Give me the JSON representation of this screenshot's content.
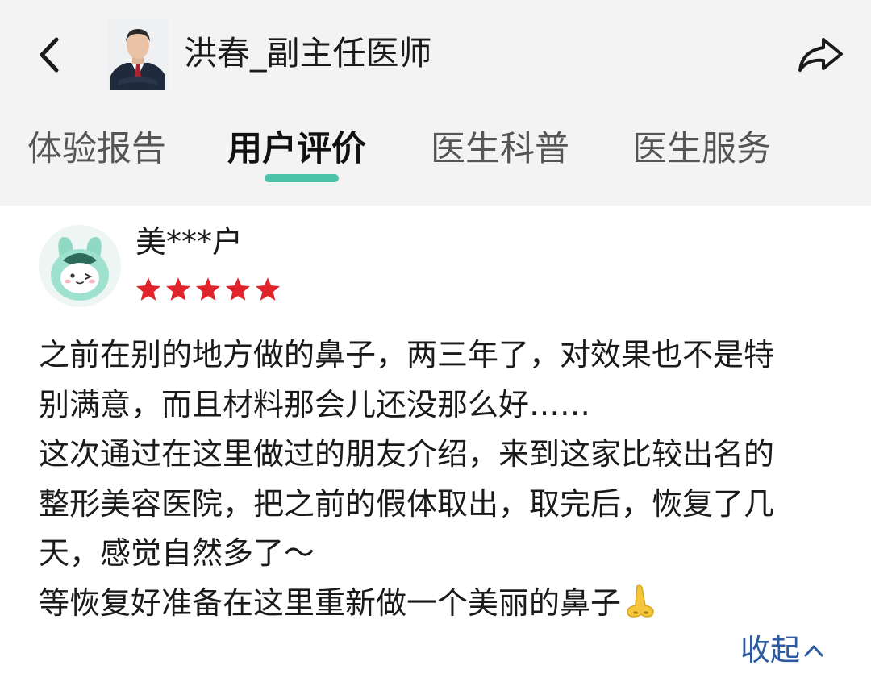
{
  "header": {
    "doctor_name": "洪春_副主任医师"
  },
  "tabs": [
    {
      "label": "体验报告",
      "active": false
    },
    {
      "label": "用户评价",
      "active": true
    },
    {
      "label": "医生科普",
      "active": false
    },
    {
      "label": "医生服务",
      "active": false
    }
  ],
  "colors": {
    "accent": "#4cc2a8",
    "star": "#e0242a",
    "link": "#2c5aa0",
    "header_bg": "#f3f3f3"
  },
  "review": {
    "username": "美***户",
    "rating": 5,
    "rating_max": 5,
    "text_lines": [
      "之前在别的地方做的鼻子，两三年了，对效果也不是特",
      "别满意，而且材料那会儿还没那么好……",
      "这次通过在这里做过的朋友介绍，来到这家比较出名的",
      "整形美容医院，把之前的假体取出，取完后，恢复了几",
      "天，感觉自然多了～",
      "等恢复好准备在这里重新做一个美丽的鼻子"
    ],
    "trailing_emoji": "nose-icon",
    "collapse_label": "收起"
  },
  "icons": {
    "back": "back-chevron-icon",
    "share": "share-arrow-icon",
    "collapse": "chevron-up-icon"
  }
}
